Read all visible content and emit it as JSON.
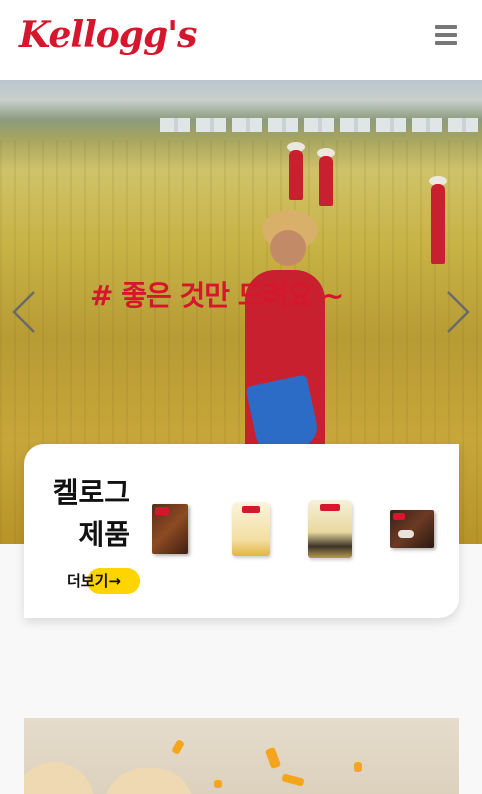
{
  "header": {
    "logo_text": "Kellogg's",
    "menu_icon": "hamburger-menu-icon"
  },
  "hero": {
    "caption": "# 좋은 것만 드려요 ~",
    "prev_icon": "chevron-left-icon",
    "next_icon": "chevron-right-icon"
  },
  "products": {
    "title_line1": "켈로그",
    "title_line2": "제품",
    "more_label": "더보기→",
    "items": [
      "product-1",
      "product-2",
      "product-3",
      "product-4"
    ]
  },
  "colors": {
    "brand_red": "#d6162d",
    "accent_yellow": "#ffd400",
    "menu_gray": "#777777"
  }
}
